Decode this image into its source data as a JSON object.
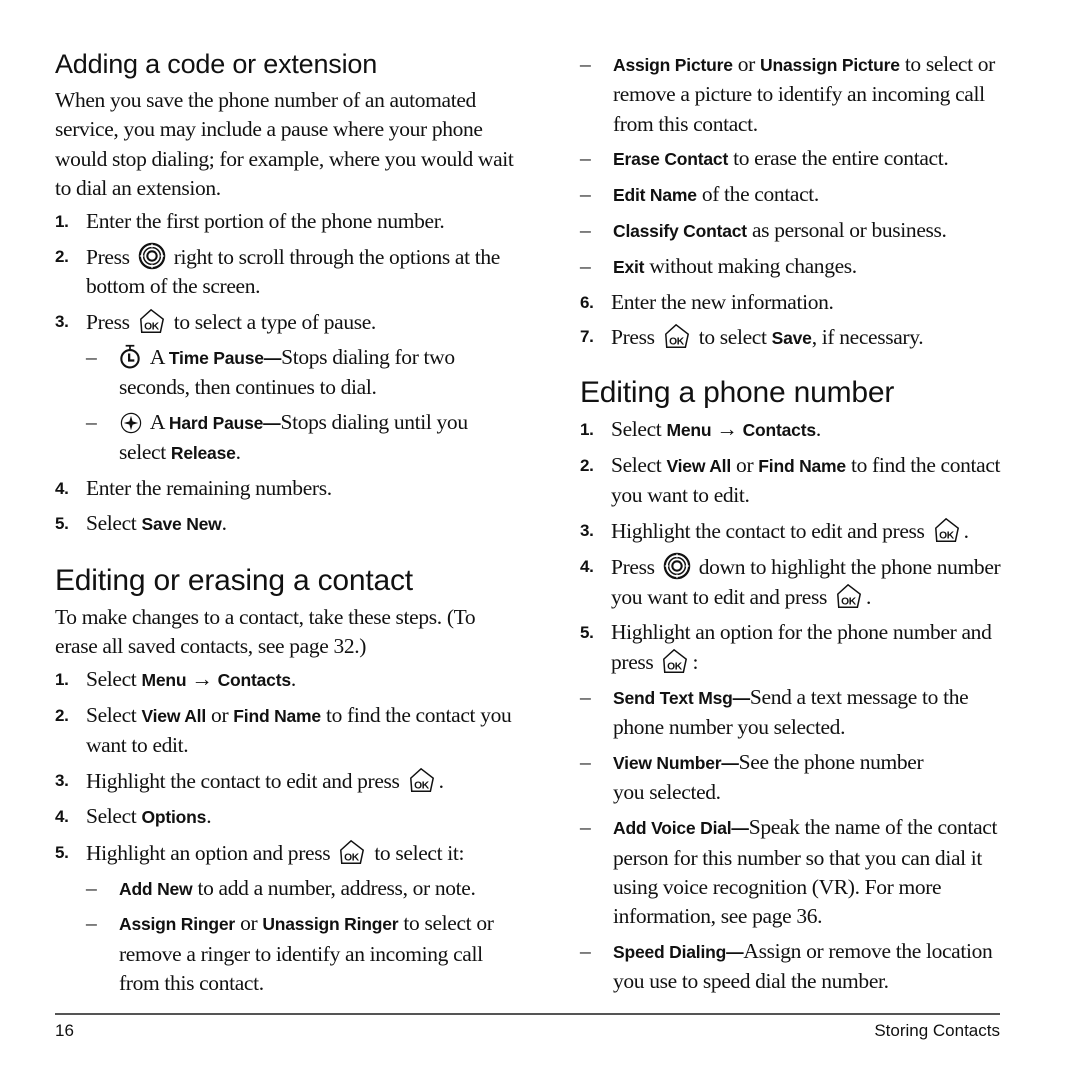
{
  "left": {
    "section1": {
      "heading": "Adding a code or extension",
      "intro": "When you save the phone number of an automated service, you may include a pause where your phone would stop dialing; for example, where you would wait to dial an extension.",
      "steps": [
        {
          "num": "1.",
          "text": "Enter the first portion of the phone number."
        },
        {
          "num": "2.",
          "pre": "Press",
          "icon": "navigation-key-icon",
          "post": "right to scroll through the options at the bottom of the screen."
        },
        {
          "num": "3.",
          "pre": "Press",
          "icon": "ok-key-icon",
          "post": "to select a type of pause."
        },
        {
          "num": "4.",
          "text": "Enter the remaining numbers."
        },
        {
          "num": "5.",
          "pre": "Select",
          "bold": "Save New",
          "post": "."
        }
      ],
      "pause_options": [
        {
          "dash": "–",
          "icon": "timer-icon",
          "pre": "A",
          "bold": "Time Pause—",
          "post": "Stops dialing for two seconds, then continues to dial."
        },
        {
          "dash": "–",
          "icon": "hard-pause-icon",
          "pre": "A",
          "bold": "Hard Pause—",
          "post": "Stops dialing until you select",
          "bold2": "Release",
          "post2": "."
        }
      ]
    },
    "section2": {
      "heading": "Editing or erasing a contact",
      "intro": "To make changes to a contact, take these steps. (To erase all saved contacts, see page 32.)",
      "steps": [
        {
          "num": "1.",
          "pre": "Select",
          "bold": "Menu",
          "arrow": "→",
          "bold2": "Contacts",
          "post": "."
        },
        {
          "num": "2.",
          "pre": "Select",
          "bold": "View All",
          "mid": "or",
          "bold2": "Find Name",
          "post": "to find the contact you want to edit."
        },
        {
          "num": "3.",
          "pre": "Highlight the contact to edit and press",
          "icon": "ok-key-icon",
          "post": "."
        },
        {
          "num": "4.",
          "pre": "Select",
          "bold": "Options",
          "post": "."
        },
        {
          "num": "5.",
          "pre": "Highlight an option and press",
          "icon": "ok-key-icon",
          "post": "to select it:"
        }
      ],
      "options": [
        {
          "dash": "–",
          "bold": "Add New",
          "post": "to add a number, address, or note."
        },
        {
          "dash": "–",
          "bold": "Assign Ringer",
          "mid": "or",
          "bold2": "Unassign Ringer",
          "post": "to select or remove a ringer to identify an incoming call from this contact."
        }
      ]
    }
  },
  "right": {
    "options_cont": [
      {
        "dash": "–",
        "bold": "Assign Picture",
        "mid": "or",
        "bold2": "Unassign Picture",
        "post": "to select or remove a picture to identify an incoming call from this contact."
      },
      {
        "dash": "–",
        "bold": "Erase Contact",
        "post": "to erase the entire contact."
      },
      {
        "dash": "–",
        "bold": "Edit Name",
        "post": "of the contact."
      },
      {
        "dash": "–",
        "bold": "Classify Contact",
        "post": "as personal or business."
      },
      {
        "dash": "–",
        "bold": "Exit",
        "post": "without making changes."
      }
    ],
    "steps_cont": [
      {
        "num": "6.",
        "text": "Enter the new information."
      },
      {
        "num": "7.",
        "pre": "Press",
        "icon": "ok-key-icon",
        "post": "to select",
        "bold": "Save",
        "post2": ", if necessary."
      }
    ],
    "section3": {
      "heading": "Editing a phone number",
      "steps": [
        {
          "num": "1.",
          "pre": "Select",
          "bold": "Menu",
          "arrow": "→",
          "bold2": "Contacts",
          "post": "."
        },
        {
          "num": "2.",
          "pre": "Select",
          "bold": "View All",
          "mid": "or",
          "bold2": "Find Name",
          "post": "to find the contact you want to edit."
        },
        {
          "num": "3.",
          "pre": "Highlight the contact to edit and press",
          "icon": "ok-key-icon",
          "post": "."
        },
        {
          "num": "4.",
          "pre": "Press",
          "icon": "navigation-key-icon",
          "post": "down to highlight the phone number you want to edit and press",
          "icon2": "ok-key-icon",
          "post2": "."
        },
        {
          "num": "5.",
          "pre": "Highlight an option for the phone number and press",
          "icon": "ok-key-icon",
          "post": ":"
        }
      ],
      "options": [
        {
          "dash": "–",
          "bold": "Send Text Msg—",
          "post": "Send a text message to the phone number you selected."
        },
        {
          "dash": "–",
          "bold": "View Number—",
          "post": "See the phone number you selected."
        },
        {
          "dash": "–",
          "bold": "Add Voice Dial—",
          "post": "Speak the name of the contact person for this number so that you can dial it using voice recognition (VR). For more information, see page 36."
        },
        {
          "dash": "–",
          "bold": "Speed Dialing—",
          "post": "Assign or remove the location you use to speed dial the number."
        }
      ]
    }
  },
  "footer": {
    "page_number": "16",
    "section_title": "Storing Contacts"
  }
}
